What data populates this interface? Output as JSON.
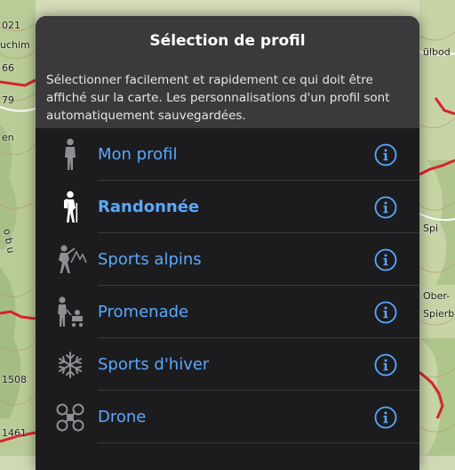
{
  "map": {
    "labels": [
      "021",
      "uchim",
      "66",
      "79",
      "en",
      "1508",
      "1461",
      "ülbod",
      "Spi",
      "Ober-",
      "Spierb",
      "o b u"
    ]
  },
  "dialog": {
    "title": "Sélection de profil",
    "description": "Sélectionner facilement et rapidement ce qui doit être affiché sur la carte. Les personnalisations d'un profil sont automatiquement sauvegardées.",
    "accent_color": "#5aa8ff",
    "profiles": [
      {
        "label": "Mon profil",
        "icon": "walking-person-icon",
        "selected": false
      },
      {
        "label": "Randonnée",
        "icon": "hiker-icon",
        "selected": true
      },
      {
        "label": "Sports alpins",
        "icon": "climber-icon",
        "selected": false
      },
      {
        "label": "Promenade",
        "icon": "stroller-family-icon",
        "selected": false
      },
      {
        "label": "Sports d'hiver",
        "icon": "snowflake-icon",
        "selected": false
      },
      {
        "label": "Drone",
        "icon": "drone-icon",
        "selected": false
      }
    ]
  }
}
